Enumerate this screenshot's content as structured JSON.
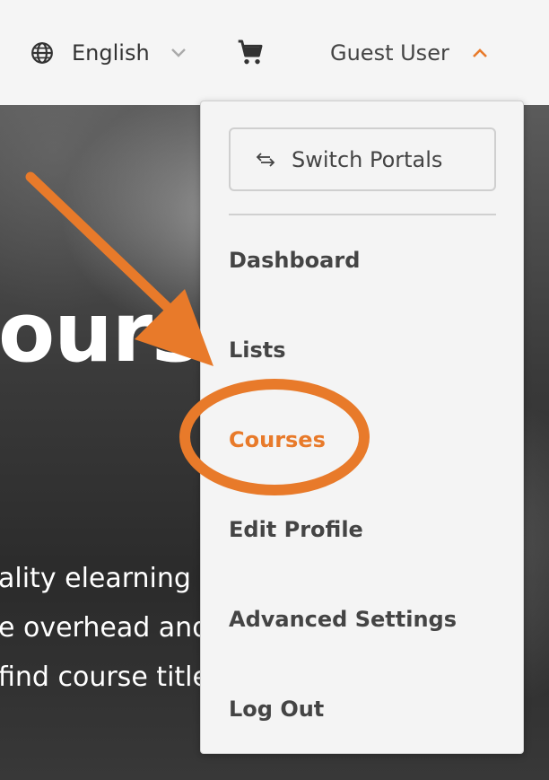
{
  "header": {
    "language_label": "English",
    "user_label": "Guest User",
    "icons": [
      "globe-icon",
      "chevron-down-icon",
      "cart-icon",
      "chevron-up-icon"
    ]
  },
  "hero": {
    "title_fragment": "ourse",
    "lines": [
      "ality elearning c",
      "e overhead and",
      "find course title"
    ]
  },
  "menu": {
    "switch_portals_label": "Switch Portals",
    "items": [
      {
        "label": "Dashboard"
      },
      {
        "label": "Lists"
      },
      {
        "label": "Courses",
        "active": true
      },
      {
        "label": "Edit Profile"
      },
      {
        "label": "Advanced Settings"
      },
      {
        "label": "Log Out"
      }
    ]
  },
  "colors": {
    "accent": "#e87a2a",
    "header_bg": "#f5f5f5",
    "menu_bg": "#f4f4f4",
    "text": "#444444"
  }
}
